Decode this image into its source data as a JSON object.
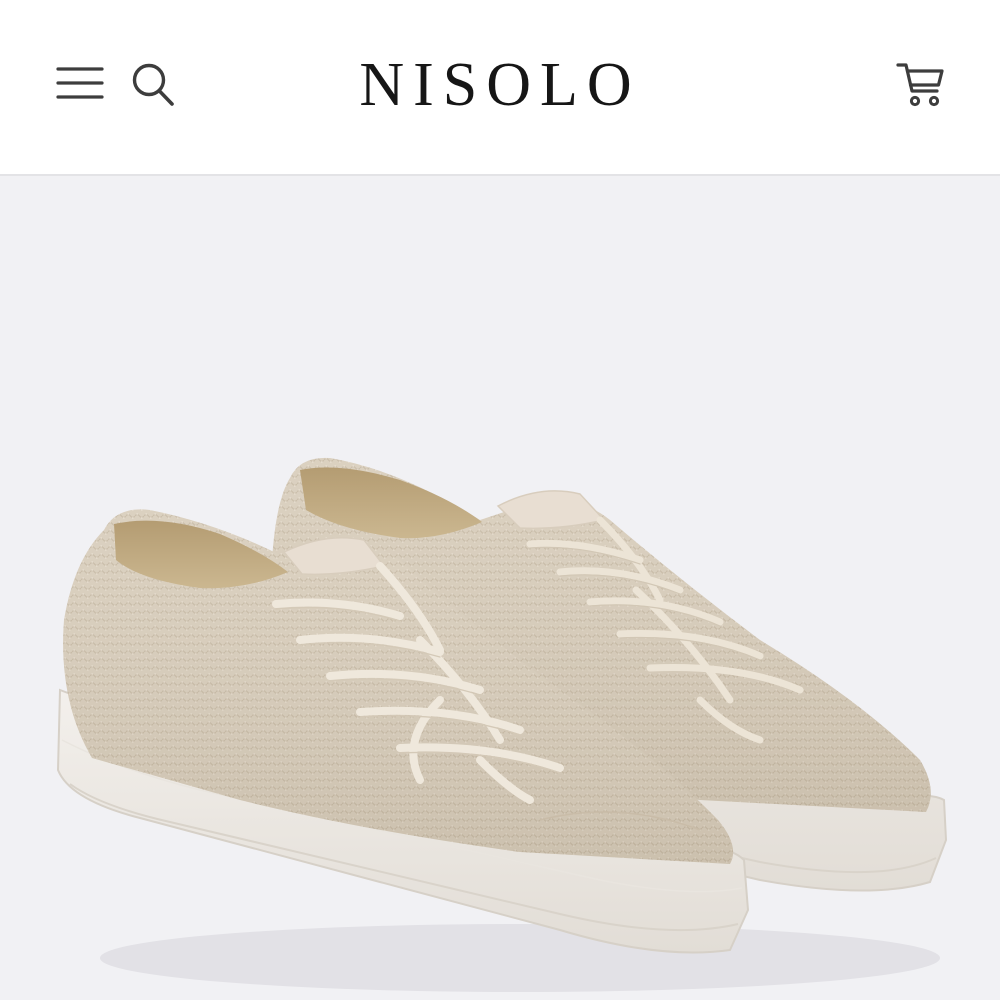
{
  "header": {
    "brand": "NISOLO",
    "icons": {
      "menu": "hamburger-menu-icon",
      "search": "search-icon",
      "cart": "shopping-cart-icon"
    }
  },
  "hero": {
    "product_image": "beige-knit-lace-up-sneakers-pair"
  },
  "colors": {
    "header_background": "#ffffff",
    "hero_background": "#f1f1f4",
    "logo_text": "#161616",
    "icon_stroke": "#3d3d3d",
    "shoe_knit": "#d9cebd",
    "shoe_sole": "#efebe6",
    "laces": "#ece4d6"
  }
}
